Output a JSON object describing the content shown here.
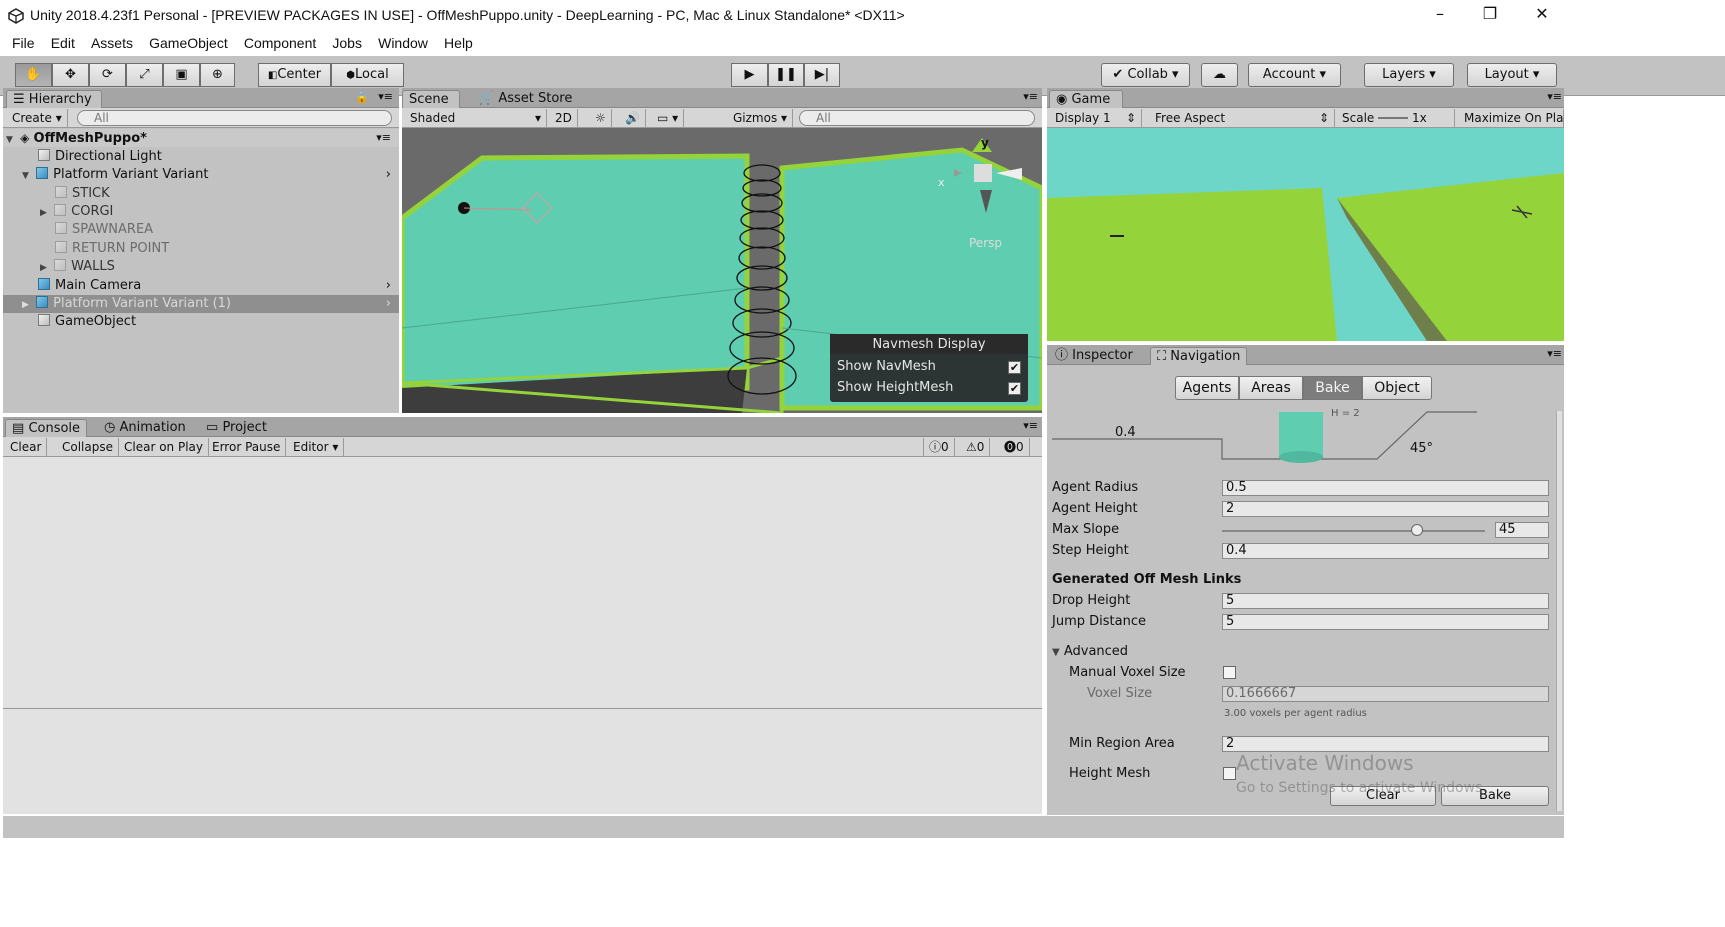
{
  "window": {
    "title": "Unity 2018.4.23f1 Personal - [PREVIEW PACKAGES IN USE] - OffMeshPuppo.unity - DeepLearning - PC, Mac & Linux Standalone* <DX11>",
    "minimize": "–",
    "restore": "❐",
    "close": "✕"
  },
  "menu": [
    "File",
    "Edit",
    "Assets",
    "GameObject",
    "Component",
    "Jobs",
    "Window",
    "Help"
  ],
  "toolbar": {
    "pivot": "Center",
    "space": "Local",
    "collab": "Collab",
    "account": "Account",
    "layers": "Layers",
    "layout": "Layout"
  },
  "hierarchy": {
    "tab": "Hierarchy",
    "create": "Create",
    "search": "All",
    "scene": "OffMeshPuppo*",
    "items": [
      {
        "label": "Directional Light"
      },
      {
        "label": "Platform Variant Variant"
      },
      {
        "label": "STICK"
      },
      {
        "label": "CORGI"
      },
      {
        "label": "SPAWNAREA"
      },
      {
        "label": "RETURN POINT"
      },
      {
        "label": "WALLS"
      },
      {
        "label": "Main Camera"
      },
      {
        "label": "Platform Variant Variant (1)"
      },
      {
        "label": "GameObject"
      }
    ]
  },
  "scene": {
    "tab_scene": "Scene",
    "tab_asset": "Asset Store",
    "shading": "Shaded",
    "mode2d": "2D",
    "gizmos": "Gizmos",
    "search": "All",
    "axis_y": "y",
    "axis_x": "x",
    "persp": "Persp",
    "navmesh": {
      "title": "Navmesh Display",
      "show_navmesh": "Show NavMesh",
      "show_heightmesh": "Show HeightMesh"
    }
  },
  "game": {
    "tab": "Game",
    "display": "Display 1",
    "aspect": "Free Aspect",
    "scale_label": "Scale",
    "scale_value": "1x",
    "maximize": "Maximize On Play"
  },
  "console": {
    "tabs": [
      "Console",
      "Animation",
      "Project"
    ],
    "clear": "Clear",
    "collapse": "Collapse",
    "clear_on_play": "Clear on Play",
    "error_pause": "Error Pause",
    "editor": "Editor",
    "info_count": "0",
    "warn_count": "0",
    "error_count": "0"
  },
  "inspector": {
    "tab_inspector": "Inspector",
    "tab_navigation": "Navigation",
    "seg": [
      "Agents",
      "Areas",
      "Bake",
      "Object"
    ],
    "diagram": {
      "step": "0.4",
      "slope": "45°",
      "height_label": "H = 2"
    },
    "agent_radius_label": "Agent Radius",
    "agent_radius": "0.5",
    "agent_height_label": "Agent Height",
    "agent_height": "2",
    "max_slope_label": "Max Slope",
    "max_slope": "45",
    "step_height_label": "Step Height",
    "step_height": "0.4",
    "offmesh_header": "Generated Off Mesh Links",
    "drop_height_label": "Drop Height",
    "drop_height": "5",
    "jump_distance_label": "Jump Distance",
    "jump_distance": "5",
    "advanced_label": "Advanced",
    "manual_voxel_label": "Manual Voxel Size",
    "voxel_size_label": "Voxel Size",
    "voxel_size": "0.1666667",
    "voxel_hint": "3.00 voxels per agent radius",
    "min_region_label": "Min Region Area",
    "min_region": "2",
    "height_mesh_label": "Height Mesh",
    "clear_btn": "Clear",
    "bake_btn": "Bake",
    "watermark_1": "Activate Windows",
    "watermark_2": "Go to Settings to activate Windows."
  },
  "colors": {
    "panel": "#c2c2c2",
    "navmesh": "#5ecdb0",
    "ground": "#95d33a",
    "sky": "#6dd6c8"
  }
}
